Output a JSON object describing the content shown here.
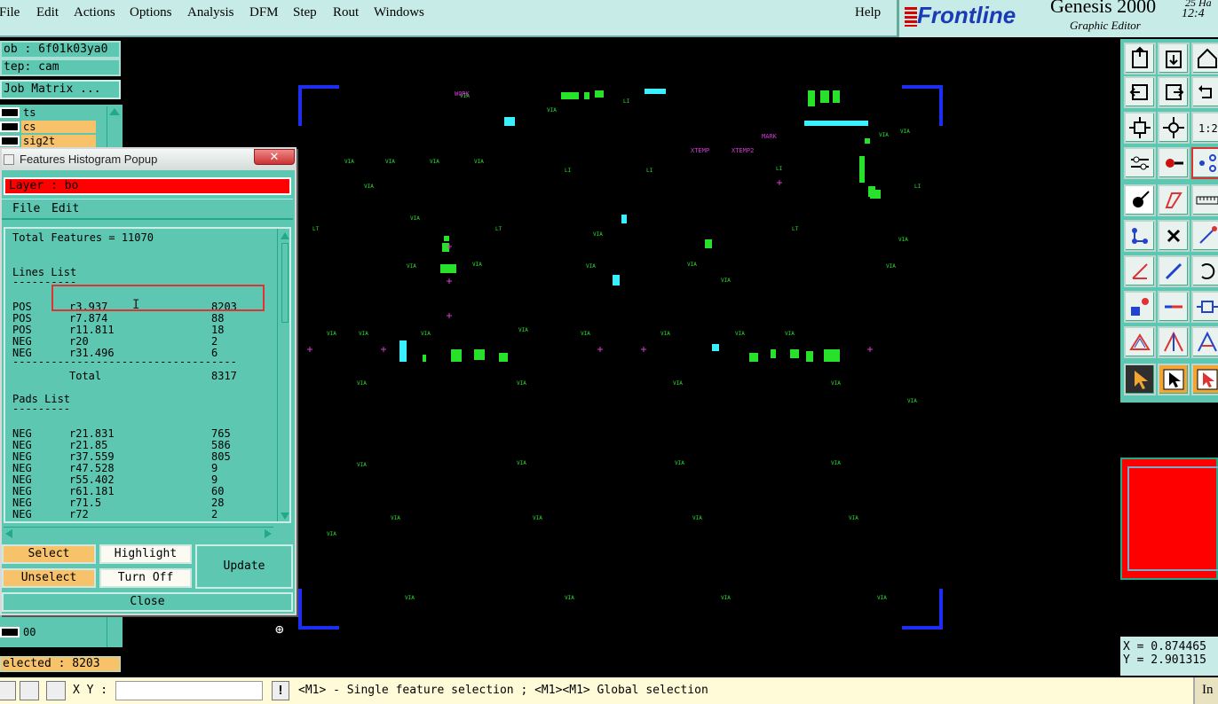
{
  "menubar": {
    "items": [
      "File",
      "Edit",
      "Actions",
      "Options",
      "Analysis",
      "DFM",
      "Step",
      "Rout",
      "Windows"
    ],
    "help": "Help"
  },
  "brand": {
    "company": "Frontline",
    "product": "Genesis 2000",
    "subtitle": "Graphic Editor",
    "date_fragment": "25 Ha",
    "time_fragment": "12:4"
  },
  "left_panel": {
    "job": "ob : 6f01k03ya0",
    "step": "tep: cam",
    "job_matrix": "Job Matrix ...",
    "layers": [
      {
        "name": "ts",
        "color": "#5ec7b1"
      },
      {
        "name": "cs",
        "color": "#f8c26b"
      },
      {
        "name": "sig2t",
        "color": "#f8c26b"
      }
    ],
    "bottom_layer": "00",
    "selected": "elected : 8203"
  },
  "popup": {
    "title": "Features Histogram Popup",
    "close_glyph": "✕",
    "layer": "Layer :  bo",
    "menu": {
      "file": "File",
      "edit": "Edit"
    },
    "total": "Total Features = 11070",
    "lines_header": "Lines List",
    "lines_rule": "----------",
    "lines": [
      {
        "pol": "POS",
        "sym": "r3.937",
        "count": "8203"
      },
      {
        "pol": "POS",
        "sym": "r7.874",
        "count": "88"
      },
      {
        "pol": "POS",
        "sym": "r11.811",
        "count": "18"
      },
      {
        "pol": "NEG",
        "sym": "r20",
        "count": "2"
      },
      {
        "pol": "NEG",
        "sym": "r31.496",
        "count": "6"
      }
    ],
    "total_rule": "-----------------------------------",
    "total_label": "Total",
    "total_count": "8317",
    "pads_header": "Pads List",
    "pads_rule": "---------",
    "pads": [
      {
        "pol": "NEG",
        "sym": "r21.831",
        "count": "765"
      },
      {
        "pol": "NEG",
        "sym": "r21.85",
        "count": "586"
      },
      {
        "pol": "NEG",
        "sym": "r37.559",
        "count": "805"
      },
      {
        "pol": "NEG",
        "sym": "r47.528",
        "count": "9"
      },
      {
        "pol": "NEG",
        "sym": "r55.402",
        "count": "9"
      },
      {
        "pol": "NEG",
        "sym": "r61.181",
        "count": "60"
      },
      {
        "pol": "NEG",
        "sym": "r71.5",
        "count": "28"
      },
      {
        "pol": "NEG",
        "sym": "r72",
        "count": "2"
      }
    ],
    "buttons": {
      "select": "Select",
      "highlight": "Highlight",
      "update": "Update",
      "unselect": "Unselect",
      "turn_off": "Turn Off",
      "close": "Close"
    }
  },
  "coords": {
    "x": "X = 0.874465",
    "y": "Y = 2.901315"
  },
  "status": {
    "xy_label": "X Y :",
    "xy_value": "",
    "hint": "<M1> - Single feature selection ; <M1><M1> Global selection",
    "right_tab": "In"
  },
  "canvas_labels": [
    "WORK",
    "MARK",
    "XTEMP2",
    "XTEMP",
    "LI",
    "LT"
  ],
  "colors": {
    "panel": "#5ec7b1",
    "accent_orange": "#f8c26b",
    "layer_red": "#ff0000",
    "feature_green": "#27e12b",
    "feature_magenta": "#d23ad2",
    "frame_blue": "#1d2ef0"
  }
}
